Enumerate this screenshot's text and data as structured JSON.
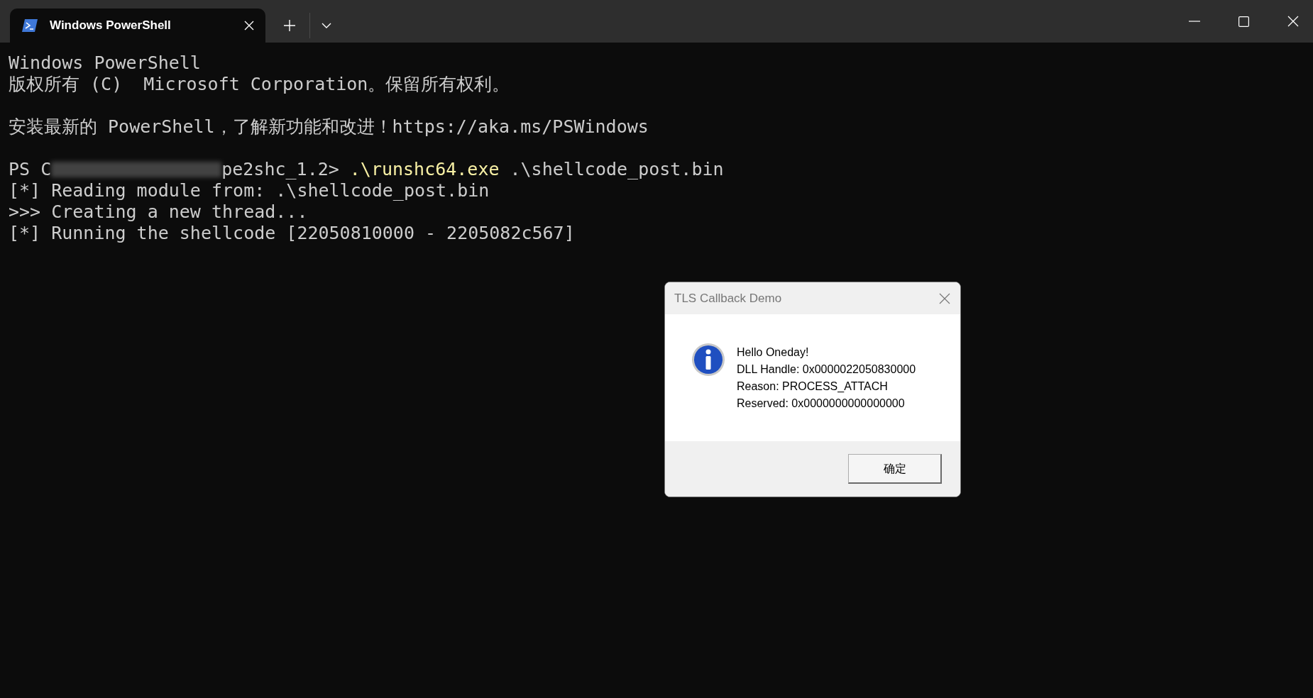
{
  "tab": {
    "title": "Windows PowerShell",
    "selected": true
  },
  "terminal": {
    "blocks": [
      [
        {
          "kind": "text",
          "text": "Windows PowerShell"
        },
        {
          "kind": "text",
          "text": "版权所有 (C)  Microsoft Corporation。保留所有权利。"
        }
      ],
      [
        {
          "kind": "text",
          "text": "安装最新的 PowerShell，了解新功能和改进！https://aka.ms/PSWindows"
        }
      ],
      [
        {
          "kind": "prompt",
          "prompt_start": "PS C",
          "prompt_end": "pe2shc_1.2>",
          "command": ".\\runshc64.exe",
          "args": ".\\shellcode_post.bin"
        },
        {
          "kind": "text",
          "text": "[*] Reading module from: .\\shellcode_post.bin"
        },
        {
          "kind": "text",
          "text": ">>> Creating a new thread..."
        },
        {
          "kind": "text",
          "text": "[*] Running the shellcode [22050810000 - 2205082c567]"
        }
      ]
    ]
  },
  "dialog": {
    "title": "TLS Callback Demo",
    "message": [
      "Hello Oneday!",
      "DLL Handle: 0x0000022050830000",
      "Reason: PROCESS_ATTACH",
      "Reserved: 0x0000000000000000"
    ],
    "button": "确定"
  }
}
